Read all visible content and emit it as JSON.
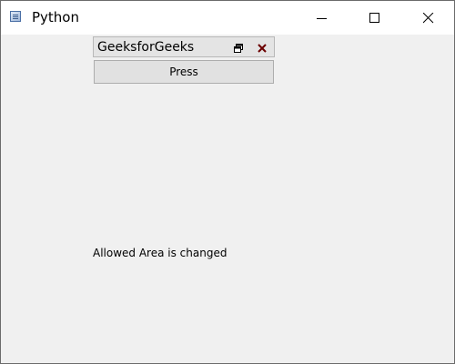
{
  "window": {
    "title": "Python",
    "app_icon": "python-app-icon",
    "controls": {
      "minimize_icon": "minimize-icon",
      "maximize_icon": "maximize-icon",
      "close_icon": "close-icon"
    }
  },
  "dock_widget": {
    "title": "GeeksforGeeks",
    "float_icon": "float-restore-icon",
    "close_icon": "close-icon",
    "button_label": "Press"
  },
  "status": {
    "label": "Allowed Area is changed"
  },
  "colors": {
    "window_background": "#f0f0f0",
    "titlebar_background": "#ffffff",
    "dock_title_background": "#e4e4e4",
    "button_background": "#e1e1e1"
  }
}
